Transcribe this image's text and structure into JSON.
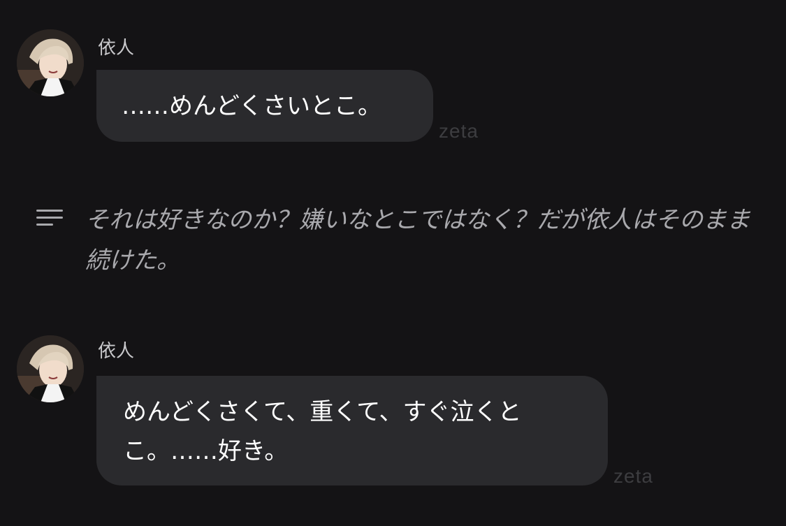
{
  "messages": [
    {
      "sender": "依人",
      "text": "……めんどくさいとこ。",
      "watermark": "zeta",
      "avatar_icon": "character-avatar"
    },
    {
      "sender": "依人",
      "text": "めんどくさくて、重くて、すぐ泣くとこ。……好き。",
      "watermark": "zeta",
      "avatar_icon": "character-avatar"
    }
  ],
  "narration": {
    "icon": "narration-lines-icon",
    "text": "それは好きなのか？嫌いなとこではなく？だが依人はそのまま続けた。"
  },
  "colors": {
    "background": "#141315",
    "bubble": "#2a2a2d",
    "sender": "#c9c9cc",
    "narration": "#a9a9ad",
    "watermark": "#3d3d40"
  }
}
